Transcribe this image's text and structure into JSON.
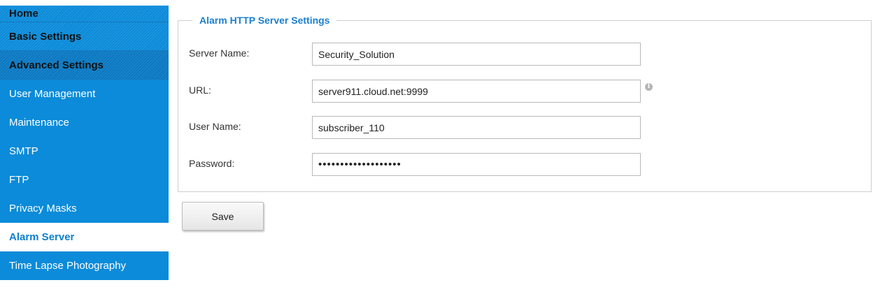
{
  "sidebar": {
    "items": [
      {
        "label": "Home"
      },
      {
        "label": "Basic Settings"
      },
      {
        "label": "Advanced Settings"
      },
      {
        "label": "User Management"
      },
      {
        "label": "Maintenance"
      },
      {
        "label": "SMTP"
      },
      {
        "label": "FTP"
      },
      {
        "label": "Privacy Masks"
      },
      {
        "label": "Alarm Server"
      },
      {
        "label": "Time Lapse Photography"
      }
    ],
    "active": "Alarm Server"
  },
  "form": {
    "legend": "Alarm HTTP Server Settings",
    "server_name": {
      "label": "Server Name:",
      "value": "Security_Solution"
    },
    "url": {
      "label": "URL:",
      "value": "server911.cloud.net:9999"
    },
    "user_name": {
      "label": "User Name:",
      "value": "subscriber_110"
    },
    "password": {
      "label": "Password:",
      "value": "•••••••••••••••••••"
    }
  },
  "save_label": "Save",
  "colors": {
    "sidebar_bg": "#0b8bd9",
    "accent": "#1a7fd0",
    "active_bg": "#ffffff"
  },
  "icons": {
    "url_hint": "info-icon"
  }
}
